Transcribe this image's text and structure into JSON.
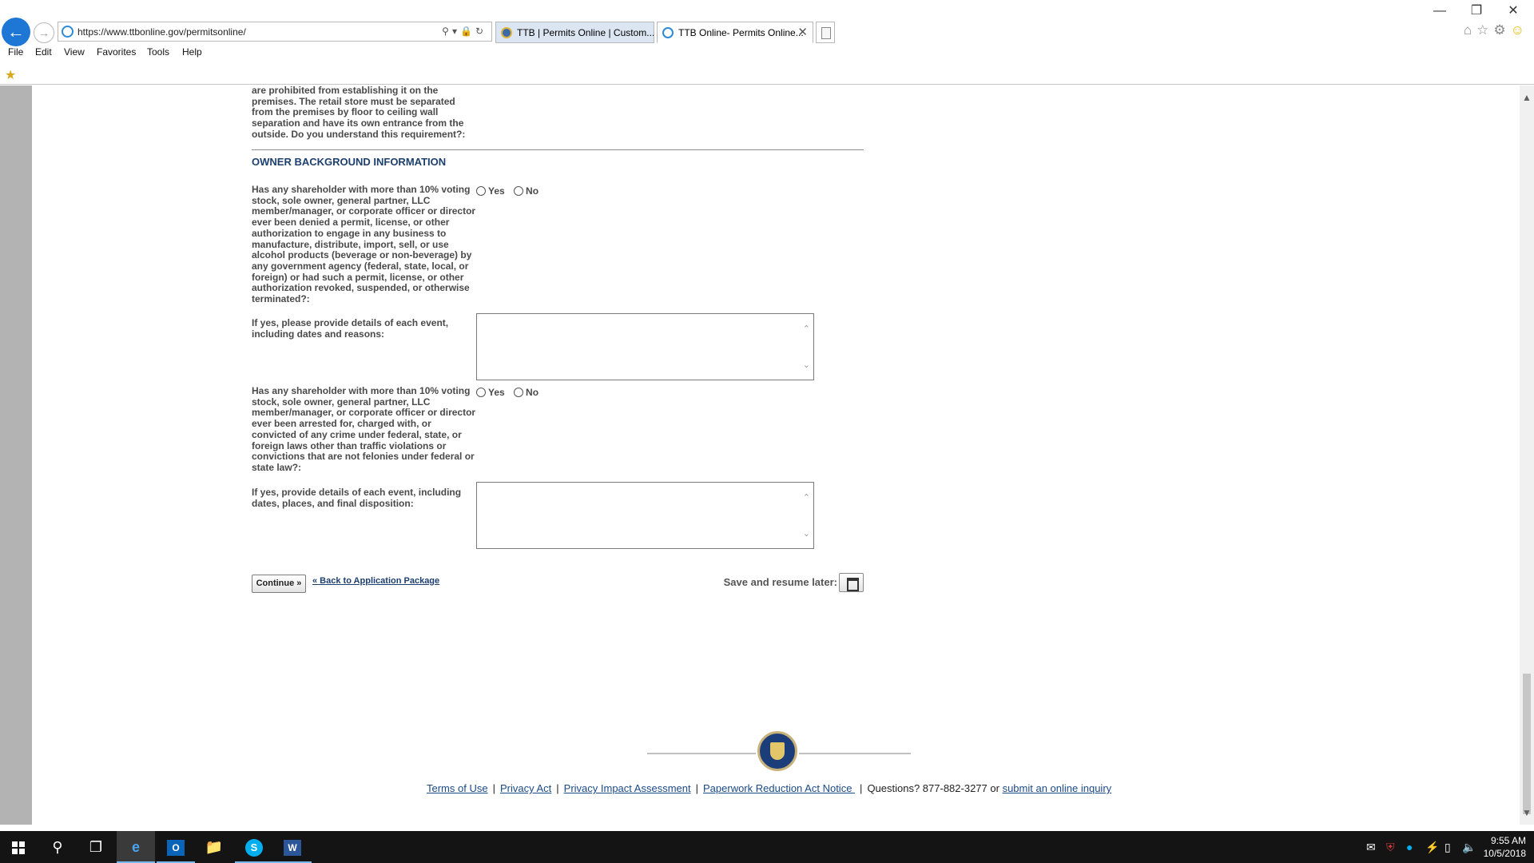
{
  "browser": {
    "url": "https://www.ttbonline.gov/permitsonline/",
    "tabs": [
      {
        "label": "TTB | Permits Online | Custom..."
      },
      {
        "label": "TTB Online- Permits Online..."
      }
    ],
    "menu": [
      "File",
      "Edit",
      "View",
      "Favorites",
      "Tools",
      "Help"
    ]
  },
  "form": {
    "intro_text": "are prohibited from establishing it on the premises. The retail store must be separated from the premises by floor to ceiling wall separation and have its own entrance from the outside. Do you understand this requirement?:",
    "section_title": "OWNER BACKGROUND INFORMATION",
    "q1_text": "Has any shareholder with more than 10% voting stock, sole owner, general partner, LLC member/manager, or corporate officer or director ever been denied a permit, license, or other authorization to engage in any business to manufacture, distribute, import, sell, or use alcohol products (beverage or non-beverage) by any government agency (federal, state, local, or foreign) or had such a permit, license, or other authorization revoked, suspended, or otherwise terminated?:",
    "q2_text": "If yes, please provide details of each event, including dates and reasons:",
    "q3_text": "Has any shareholder with more than 10% voting stock, sole owner, general partner, LLC member/manager, or corporate officer or director ever been arrested for, charged with, or convicted of any crime under federal, state, or foreign laws other than traffic violations or convictions that are not felonies under federal or state law?:",
    "q4_text": "If yes, provide details of each event, including dates, places, and final disposition:",
    "yes_label": "Yes",
    "no_label": "No",
    "continue_label": "Continue »",
    "back_label": "« Back to Application Package",
    "save_label": "Save and resume later:"
  },
  "footer": {
    "terms": "Terms of Use",
    "privacy": "Privacy Act",
    "pia": "Privacy Impact Assessment",
    "prn": "Paperwork Reduction Act Notice ",
    "questions": "Questions? 877-882-3277 or",
    "inquiry": "submit an online inquiry",
    "separator": "|"
  },
  "taskbar": {
    "time": "9:55 AM",
    "date": "10/5/2018"
  },
  "icons": {
    "back": "back-arrow-icon",
    "forward": "forward-arrow-icon",
    "search": "search-icon",
    "lock": "lock-icon",
    "refresh": "refresh-icon",
    "home": "home-icon",
    "favorites": "star-icon",
    "settings": "gear-icon",
    "feedback": "smiley-icon"
  },
  "colors": {
    "accent": "#1e77d4",
    "section_title": "#1d3f6e",
    "link": "#1b4a86",
    "taskbar": "#141414"
  }
}
